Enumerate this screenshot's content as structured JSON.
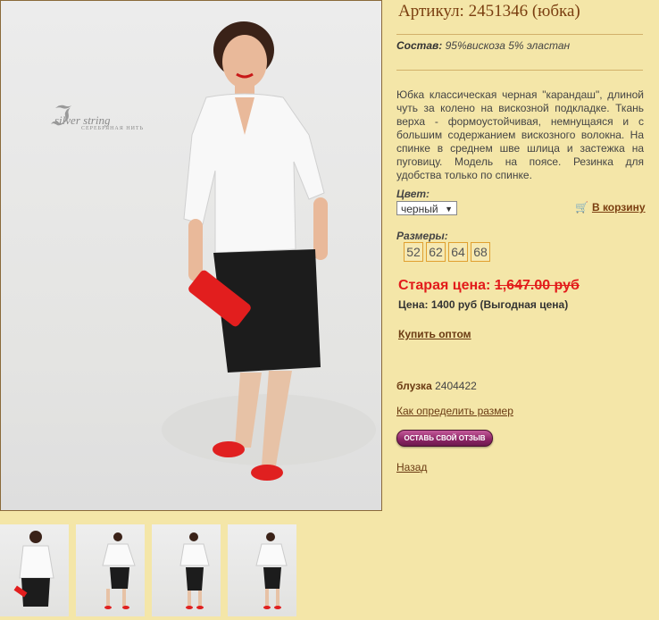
{
  "product": {
    "title": "Артикул: 2451346 (юбка)",
    "composition_label": "Состав:",
    "composition_value": "95%вискоза 5% эластан",
    "description": "Юбка классическая черная \"карандаш\", длиной чуть за колено на вискозной подкладке. Ткань верха - формоустойчивая, немнущаяся и с большим содержанием вискозного волокна. На спинке в среднем шве шлица и застежка на пуговицу. Модель на поясе. Резинка для удобства только по спинке."
  },
  "photo": {
    "logo_text": "silver string",
    "logo_sub": "СЕРЕБРЯНАЯ НИТЬ"
  },
  "color": {
    "label": "Цвет:",
    "selected": "черный"
  },
  "cart": {
    "label": "В корзину",
    "icon": "cart-icon"
  },
  "sizes": {
    "label": "Размеры:",
    "values": [
      "52",
      "62",
      "64",
      "68"
    ]
  },
  "pricing": {
    "old_label": "Старая цена:",
    "old_value": "1,647.00 руб",
    "price": "Цена: 1400 руб (Выгодная цена)"
  },
  "links": {
    "wholesale": "Купить оптом",
    "size_guide": "Как определить размер",
    "back": "Назад"
  },
  "related": {
    "name": "блузка",
    "article": "2404422"
  },
  "review_button": "ОСТАВЬ СВОЙ ОТЗЫВ",
  "colors": {
    "background": "#f4e6a8",
    "accent_brown": "#7a3e10",
    "old_price_red": "#e21b1b",
    "review_button": "#8b2464"
  }
}
